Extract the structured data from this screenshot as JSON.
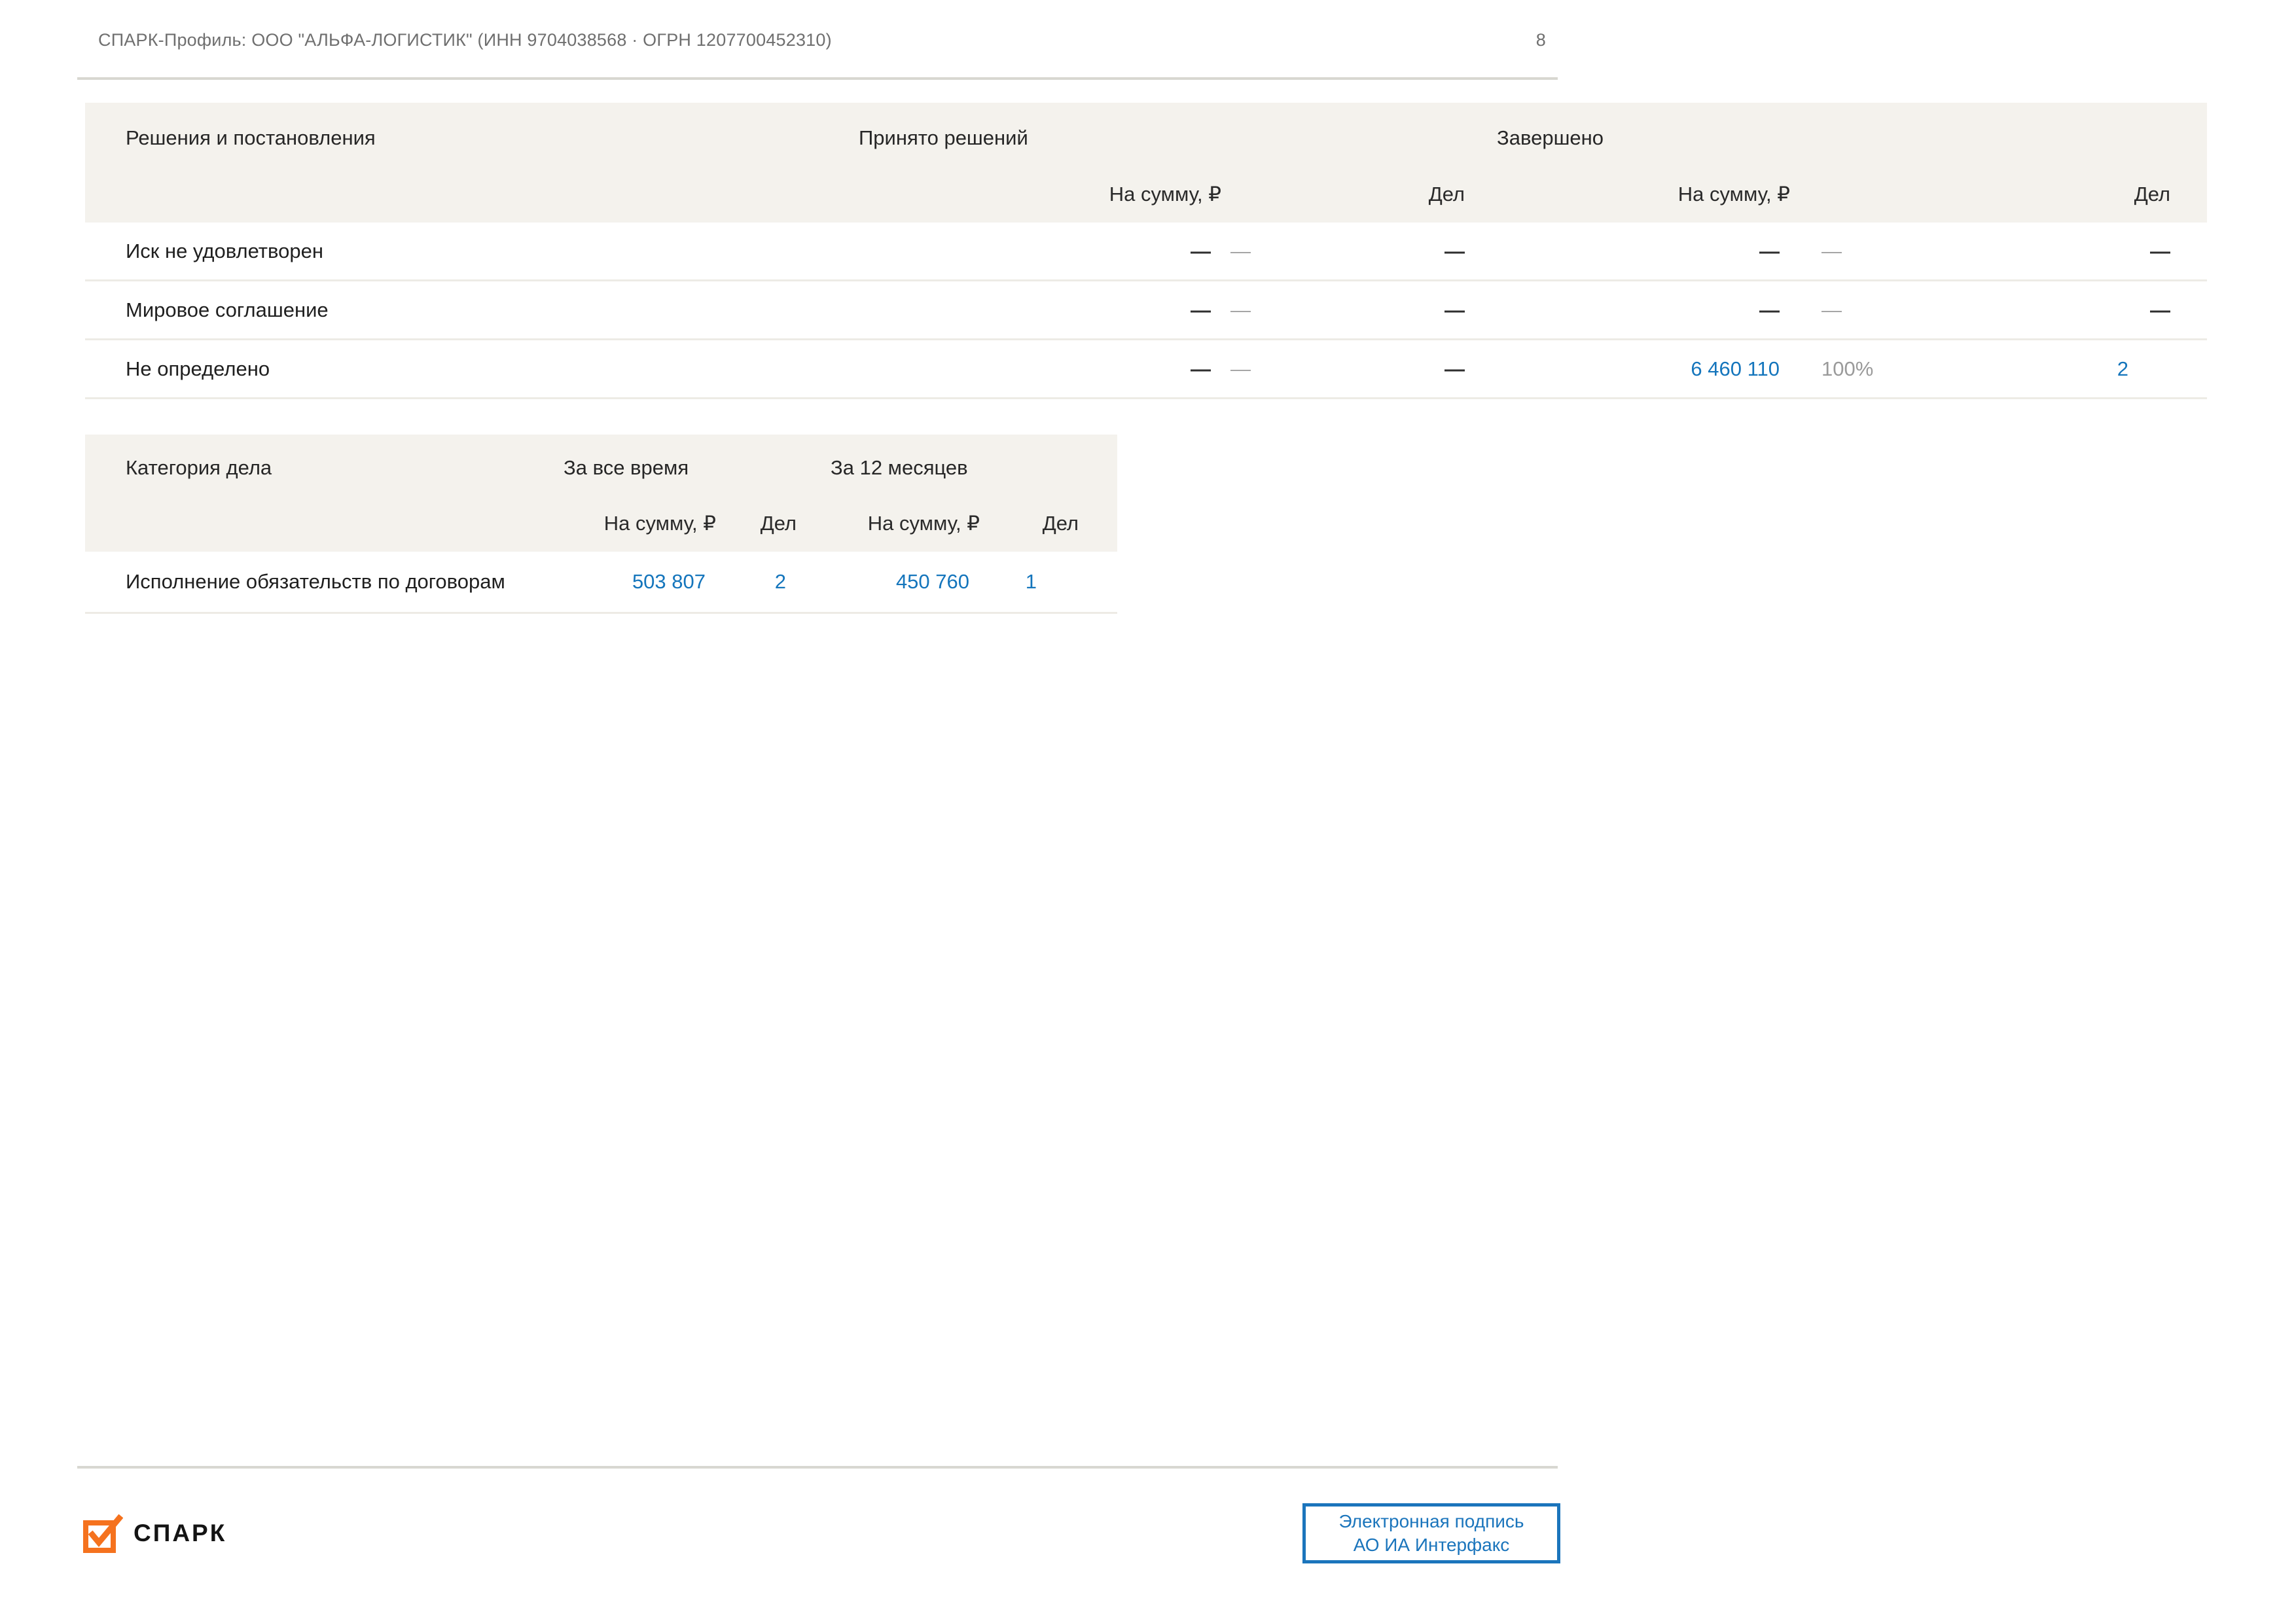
{
  "page": {
    "header_title": "СПАРК-Профиль: ООО \"АЛЬФА-ЛОГИСТИК\" (ИНН 9704038568 · ОГРН 1207700452310)",
    "page_number": "8"
  },
  "colors": {
    "link_blue": "#1475bc",
    "stamp_blue": "#1b75bc",
    "header_band": "#f4f2ed",
    "logo_orange": "#f5721e"
  },
  "decisions_table": {
    "title": "Решения и постановления",
    "group_accepted": "Принято решений",
    "group_finished": "Завершено",
    "col_sum_accepted": "На сумму, ₽",
    "col_cases_accepted": "Дел",
    "col_sum_finished": "На сумму, ₽",
    "col_cases_finished": "Дел",
    "rows": [
      {
        "label": "Иск не удовлетворен",
        "accepted_sum": "—",
        "accepted_pct": "—",
        "accepted_cases": "—",
        "finished_sum": "—",
        "finished_pct": "—",
        "finished_cases": "—"
      },
      {
        "label": "Мировое соглашение",
        "accepted_sum": "—",
        "accepted_pct": "—",
        "accepted_cases": "—",
        "finished_sum": "—",
        "finished_pct": "—",
        "finished_cases": "—"
      },
      {
        "label": "Не определено",
        "accepted_sum": "—",
        "accepted_pct": "—",
        "accepted_cases": "—",
        "finished_sum": "6 460 110",
        "finished_pct": "100%",
        "finished_cases": "2"
      }
    ]
  },
  "categories_table": {
    "title": "Категория дела",
    "group_all_time": "За все время",
    "group_12_months": "За 12 месяцев",
    "col_sum_all": "На сумму, ₽",
    "col_cases_all": "Дел",
    "col_sum_12m": "На сумму, ₽",
    "col_cases_12m": "Дел",
    "rows": [
      {
        "label": "Исполнение обязательств по договорам",
        "all_time_sum": "503 807",
        "all_time_cases": "2",
        "last12_sum": "450 760",
        "last12_cases": "1"
      }
    ]
  },
  "footer": {
    "logo_text": "СПАРК",
    "stamp_line1": "Электронная подпись",
    "stamp_line2": "АО ИА Интерфакс"
  }
}
